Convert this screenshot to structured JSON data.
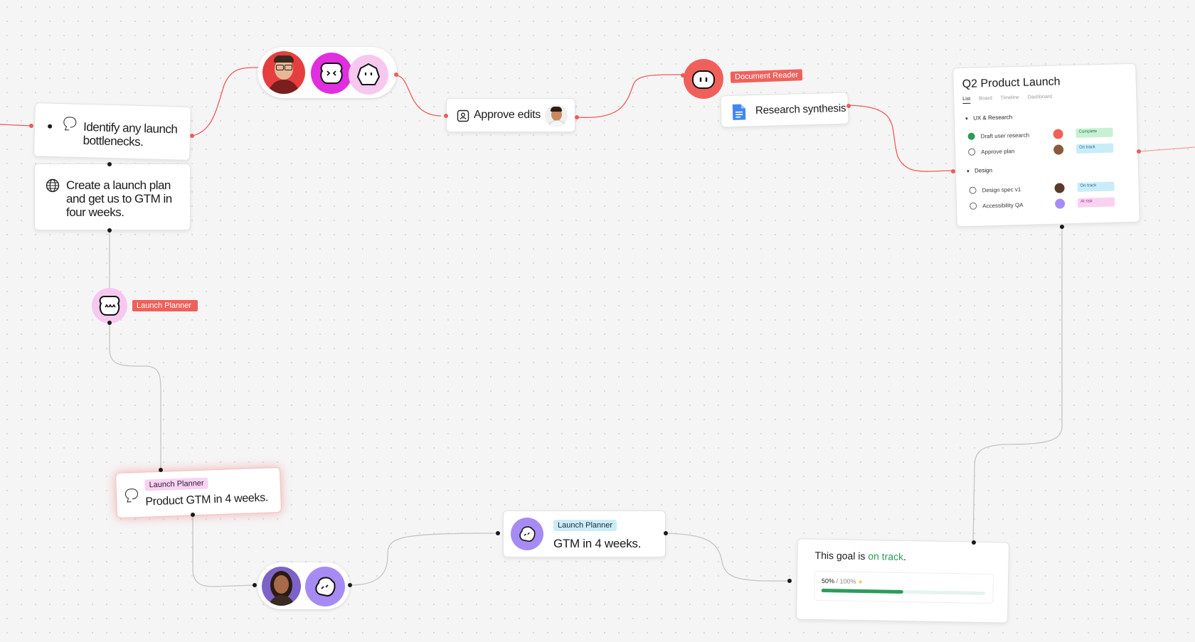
{
  "nodes": {
    "identify_text": "Identify any launch bottlenecks.",
    "create_plan_text": "Create a launch plan and get us to GTM in four weeks.",
    "launch_planner_tag": "Launch Planner",
    "product_gtm": {
      "tag": "Launch Planner",
      "text": "Product GTM in 4 weeks."
    },
    "gtm": {
      "tag": "Launch Planner",
      "text": "GTM in 4 weeks."
    },
    "approve_edits": "Approve edits",
    "document_reader_tag": "Document Reader",
    "research_synthesis": "Research synthesis"
  },
  "project": {
    "title": "Q2 Product Launch",
    "tabs": [
      "List",
      "Board",
      "Timeline",
      "Dashboard"
    ],
    "sections": [
      {
        "name": "UX & Research",
        "tasks": [
          {
            "name": "Draft user research",
            "done": true,
            "status": "Complete"
          },
          {
            "name": "Approve plan",
            "done": false,
            "status": "On track"
          }
        ]
      },
      {
        "name": "Design",
        "tasks": [
          {
            "name": "Design spec v1",
            "done": false,
            "status": "On track"
          },
          {
            "name": "Accessibility QA",
            "done": false,
            "status": "At risk"
          }
        ]
      }
    ]
  },
  "goal": {
    "prefix": "This goal is ",
    "status": "on track",
    "suffix": ".",
    "progress_label": "50%",
    "target_label": "/ 100%",
    "progress": 0.5
  },
  "colors": {
    "accent_red": "#f0605a",
    "accent_pink": "#f36bb5",
    "agent_purple": "#a78bf5",
    "agent_magenta": "#e12ee0",
    "on_track_green": "#2a9d5a",
    "status_complete": "#c8f1d4",
    "status_on_track": "#c9ecf8",
    "status_at_risk": "#f9d2f2"
  }
}
